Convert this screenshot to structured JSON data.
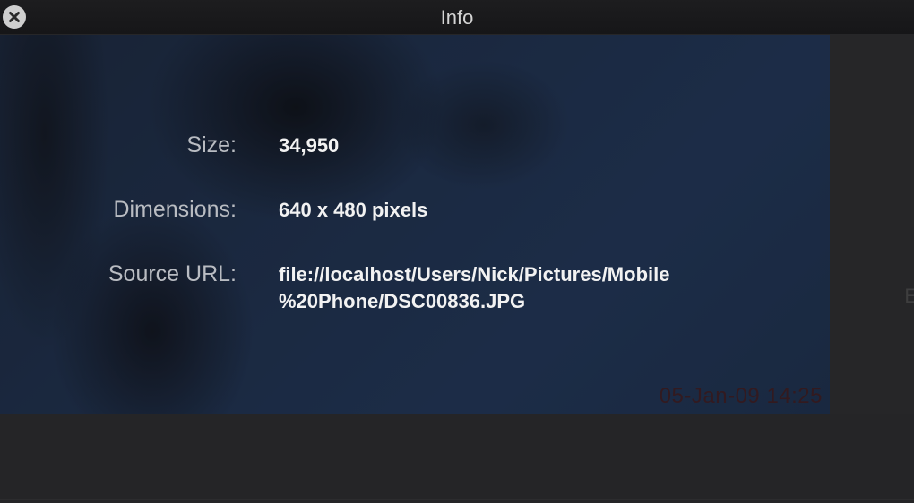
{
  "window": {
    "title": "Info",
    "close_icon": "close-icon"
  },
  "photo": {
    "date_stamp": "05-Jan-09 14:25"
  },
  "info": {
    "size_label": "Size:",
    "size_value": "34,950",
    "dimensions_label": "Dimensions:",
    "dimensions_value": "640 x 480 pixels",
    "source_label": "Source URL:",
    "source_value_line1": "file://localhost/Users/Nick/Pictures/Mobile",
    "source_value_line2": "%20Phone/DSC00836.JPG"
  },
  "side": {
    "edge_letter": "E"
  },
  "colors": {
    "stamp": "#4a1a1c",
    "label": "#b9bcc2",
    "value": "#f2f2f2"
  }
}
